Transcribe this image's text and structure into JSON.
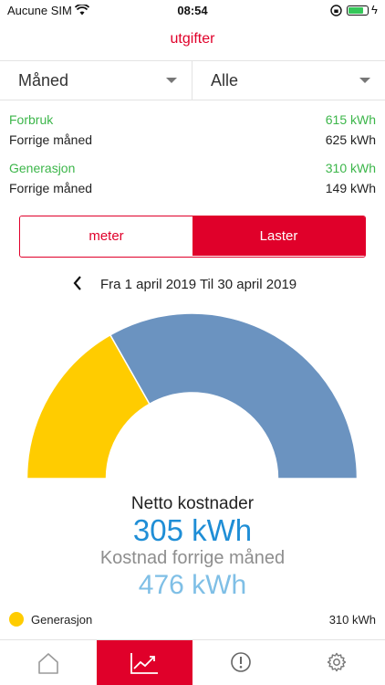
{
  "status_bar": {
    "carrier": "Aucune SIM",
    "time": "08:54"
  },
  "nav": {
    "title": "utgifter"
  },
  "filters": {
    "period": "Måned",
    "scope": "Alle"
  },
  "stats": {
    "forbruk": {
      "label": "Forbruk",
      "value": "615 kWh"
    },
    "forbruk_prev": {
      "label": "Forrige måned",
      "value": "625 kWh"
    },
    "generasjon": {
      "label": "Generasjon",
      "value": "310 kWh"
    },
    "generasjon_prev": {
      "label": "Forrige måned",
      "value": "149 kWh"
    }
  },
  "segmented": {
    "left": "meter",
    "right": "Laster",
    "selected": "right"
  },
  "period_range": "Fra 1 april 2019 Til 30 april 2019",
  "gauge": {
    "segments": [
      {
        "name": "Generasjon",
        "value": 310,
        "color": "#ffcc00"
      },
      {
        "name": "Forbruk",
        "value": 615,
        "color": "#6b93c0"
      }
    ]
  },
  "totals": {
    "net_label": "Netto kostnader",
    "net_value": "305 kWh",
    "prev_label": "Kostnad forrige måned",
    "prev_value": "476 kWh"
  },
  "legend": {
    "label": "Generasjon",
    "value": "310 kWh",
    "color": "#ffcc00"
  },
  "colors": {
    "accent": "#e0002a",
    "green": "#3cb64a",
    "blue": "#1f8ed6",
    "light_blue": "#7fbfe6",
    "gauge_blue": "#6b93c0",
    "gauge_yellow": "#ffcc00"
  },
  "tabs": [
    {
      "icon": "home-icon"
    },
    {
      "icon": "chart-trend-icon",
      "active": true
    },
    {
      "icon": "alert-icon"
    },
    {
      "icon": "gear-icon"
    }
  ]
}
